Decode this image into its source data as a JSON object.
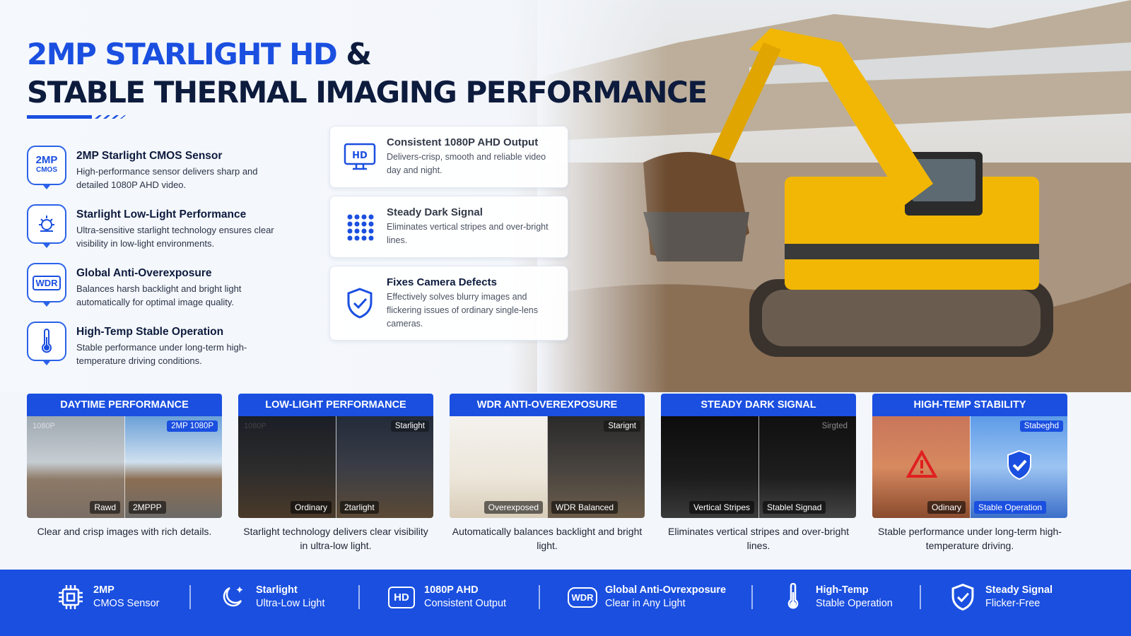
{
  "headline": {
    "line1_main": "2MP STARLIGHT HD",
    "line1_amp": "&",
    "line2": "STABLE THERMAL IMAGING PERFORMANCE"
  },
  "features": [
    {
      "icon_text_top": "2MP",
      "icon_text_bottom": "CMOS",
      "icon": "chip-icon",
      "title": "2MP Starlight CMOS Sensor",
      "desc": "High-performance sensor delivers sharp and detailed 1080P AHD video."
    },
    {
      "icon": "sun-moon-icon",
      "title": "Starlight Low-Light Performance",
      "desc": "Ultra-sensitive starlight technology ensures clear visibility in low-light environments."
    },
    {
      "icon_text_top": "WDR",
      "icon": "wdr-icon",
      "title": "Global Anti-Overexposure",
      "desc": "Balances harsh backlight and bright light automatically for optimal image quality."
    },
    {
      "icon": "thermometer-icon",
      "title": "High-Temp Stable Operation",
      "desc": "Stable performance under long-term high-temperature driving conditions."
    }
  ],
  "cards": [
    {
      "icon": "hd-monitor-icon",
      "icon_text": "HD",
      "title": "Consistent 1080P AHD Output",
      "desc": "Delivers-crisp, smooth and reliable video day and night."
    },
    {
      "icon": "dot-grid-icon",
      "title": "Steady Dark Signal",
      "desc": "Eliminates vertical stripes and over-bright lines."
    },
    {
      "icon": "shield-check-icon",
      "title": "Fixes Camera Defects",
      "desc": "Effectively solves blurry images and flickering issues of ordinary single-lens cameras."
    }
  ],
  "panels": [
    {
      "header": "DAYTIME PERFORMANCE",
      "tag_tl": "1080P",
      "tag_tr": "2MP 1080P",
      "tag_bl": "Rawd",
      "tag_br": "2MPPP",
      "caption": "Clear and crisp images with rich details."
    },
    {
      "header": "LOW-LIGHT PERFORMANCE",
      "tag_tl": "1080P",
      "tag_tr": "Starlight",
      "tag_bl": "Ordinary",
      "tag_br": "2tarlight",
      "caption": "Starlight technology delivers clear visibility in ultra-low light."
    },
    {
      "header": "WDR ANTI-OVEREXPOSURE",
      "tag_tl": "",
      "tag_tr": "Starignt",
      "tag_bl": "Overexposed",
      "tag_br": "WDR Balanced",
      "caption": "Automatically balances backlight and bright light."
    },
    {
      "header": "STEADY DARK SIGNAL",
      "tag_tl": "",
      "tag_tr": "Sirgted",
      "tag_bl": "Vertical Stripes",
      "tag_br": "Stablel Signad",
      "caption": "Eliminates vertical stripes and over-bright lines."
    },
    {
      "header": "HIGH-TEMP STABILITY",
      "tag_tl": "",
      "tag_tr": "Stabeghd",
      "tag_bl": "Odinary",
      "tag_br": "Stable Operation",
      "caption": "Stable performance under long-term high-temperature driving."
    }
  ],
  "bar": [
    {
      "icon": "chip-icon",
      "title": "2MP",
      "sub": "CMOS Sensor"
    },
    {
      "icon": "moon-star-icon",
      "title": "Starlight",
      "sub": "Ultra-Low Light"
    },
    {
      "icon": "hd-icon",
      "icon_text": "HD",
      "title": "1080P AHD",
      "sub": "Consistent Output"
    },
    {
      "icon": "wdr-icon",
      "icon_text": "WDR",
      "title": "Global Anti-Ovrexposure",
      "sub": "Clear in Any Light"
    },
    {
      "icon": "thermometer-icon",
      "title": "High-Temp",
      "sub": "Stable Operation"
    },
    {
      "icon": "shield-check-icon",
      "title": "Steady Signal",
      "sub": "Flicker-Free"
    }
  ],
  "colors": {
    "brand_blue": "#1a4fe0",
    "navy": "#0d1b3d",
    "excavator_yellow": "#f2b705"
  }
}
